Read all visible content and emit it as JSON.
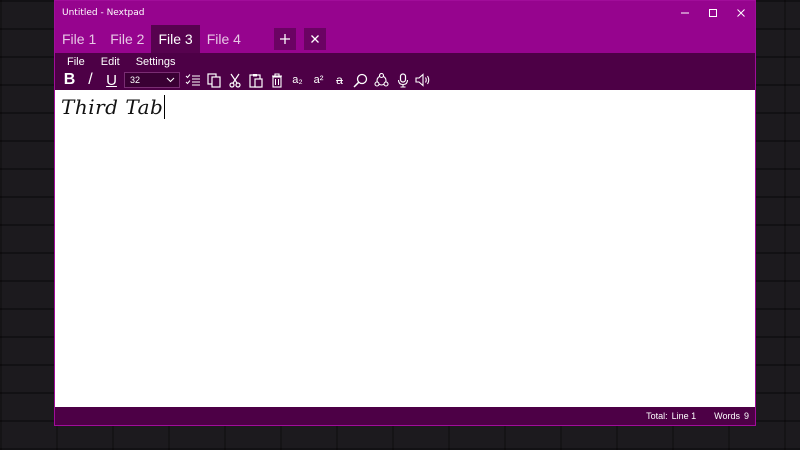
{
  "window": {
    "title": "Untitled - Nextpad"
  },
  "tabs": [
    {
      "label": "File 1",
      "active": false
    },
    {
      "label": "File 2",
      "active": false
    },
    {
      "label": "File 3",
      "active": true
    },
    {
      "label": "File 4",
      "active": false
    }
  ],
  "tab_actions": {
    "add_icon": "plus-icon",
    "close_icon": "close-icon"
  },
  "menu": {
    "file": "File",
    "edit": "Edit",
    "settings": "Settings"
  },
  "toolbar": {
    "bold": "B",
    "italic": "/",
    "underline": "U",
    "font_size": "32",
    "subscript": "a₂",
    "superscript": "a²",
    "strikethrough": "a",
    "icons": [
      "bold-icon",
      "italic-icon",
      "underline-icon",
      "checklist-icon",
      "copy-icon",
      "cut-icon",
      "paste-icon",
      "delete-icon",
      "subscript-icon",
      "superscript-icon",
      "strikethrough-icon",
      "search-icon",
      "share-icon",
      "microphone-icon",
      "speaker-icon"
    ]
  },
  "editor": {
    "content": "Third Tab"
  },
  "status": {
    "total_label": "Total:",
    "line_label": "Line 1",
    "words_label": "Words",
    "words_value": "9"
  },
  "colors": {
    "accent": "#96048e",
    "bar_dark": "#4d0046",
    "tab_active": "#57024f"
  }
}
